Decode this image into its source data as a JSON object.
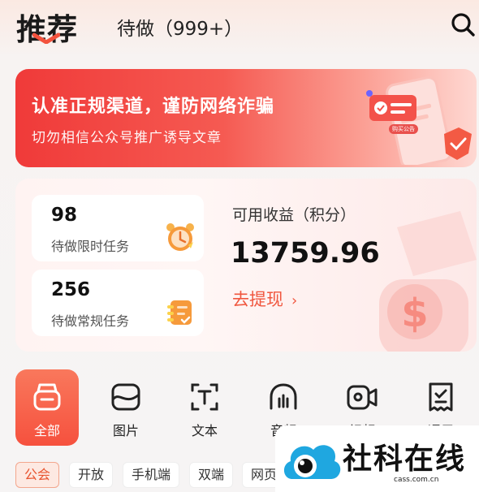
{
  "header": {
    "active_tab": "推荐",
    "tab_todo": "待做（999+）",
    "search_icon": "search-icon"
  },
  "banner": {
    "title": "认准正规渠道，谨防网络诈骗",
    "subtitle": "切勿相信公众号推广诱导文章",
    "tag": "购买公告"
  },
  "tasks": [
    {
      "count": "98",
      "label": "待做限时任务",
      "icon": "alarm-clock-icon"
    },
    {
      "count": "256",
      "label": "待做常规任务",
      "icon": "clipboard-icon"
    }
  ],
  "earnings": {
    "label": "可用收益（积分）",
    "value": "13759.96",
    "withdraw": "去提现",
    "withdraw_arrow": "›"
  },
  "categories": [
    {
      "label": "全部",
      "icon": "all-box-icon",
      "active": true
    },
    {
      "label": "图片",
      "icon": "image-icon",
      "active": false
    },
    {
      "label": "文本",
      "icon": "text-icon",
      "active": false
    },
    {
      "label": "音频",
      "icon": "audio-icon",
      "active": false
    },
    {
      "label": "视频",
      "icon": "video-icon",
      "active": false
    },
    {
      "label": "通用",
      "icon": "receipt-icon",
      "active": false
    }
  ],
  "filters": [
    "公会",
    "开放",
    "手机端",
    "双端",
    "网页"
  ],
  "watermark": {
    "text": "社科在线",
    "url": "cass.com.cn"
  },
  "colors": {
    "accent": "#f6513e",
    "banner_red": "#f03a39",
    "link_orange": "#f0563e"
  }
}
